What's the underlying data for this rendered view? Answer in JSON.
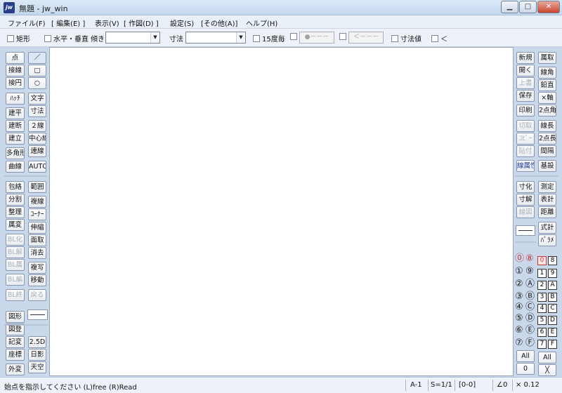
{
  "window": {
    "title": "無題 - jw_win",
    "icon": "jw"
  },
  "menu": [
    "ファイル(F)",
    "[ 編集(E) ]",
    "表示(V)",
    "[ 作図(D) ]",
    "設定(S)",
    "[その他(A)]",
    "ヘルプ(H)"
  ],
  "options": {
    "rect": "矩形",
    "hv": "水平・垂直",
    "slope": "傾き",
    "dim": "寸法",
    "deg15": "15度毎",
    "dotted": "●－－－",
    "arrow": "＜－－－",
    "dimval": "寸法値",
    "lt": "＜"
  },
  "left_tools": {
    "col1": [
      "点",
      "接線",
      "接円",
      "ﾊｯﾁ",
      "建平",
      "建断",
      "建立",
      "多角形",
      "曲線",
      "包絡",
      "分割",
      "整理",
      "属変",
      "BL化",
      "BL解",
      "BL属",
      "BL編",
      "BL終",
      "図形",
      "図登",
      "記変",
      "座標",
      "外変"
    ],
    "col2": [
      "／",
      "□",
      "○",
      "文字",
      "寸法",
      "２線",
      "中心線",
      "連線",
      "AUTO",
      "範囲",
      "複線",
      "ｺｰﾅｰ",
      "伸縮",
      "面取",
      "消去",
      "複写",
      "移動",
      "戻る",
      "2.5D",
      "日影",
      "天空"
    ]
  },
  "right_tools": {
    "col1": [
      "新規",
      "開く",
      "上書",
      "保存",
      "印刷",
      "切取",
      "ｺﾋﾟｰ",
      "貼付",
      "線属性",
      "寸化",
      "寸解",
      "線図",
      "All",
      "0"
    ],
    "col2": [
      "属取",
      "線角",
      "鉛直",
      "×軸",
      "2点角",
      "線長",
      "2点長",
      "間隔",
      "基設",
      "測定",
      "表計",
      "距離",
      "式計",
      "ﾊﾟﾗﾒ",
      "All",
      "╳"
    ],
    "layer_groups": [
      "⓪",
      "①",
      "②",
      "③",
      "④",
      "⑤",
      "⑥",
      "⑦"
    ],
    "layer_groups_b": [
      "⑧",
      "⑨",
      "Ⓐ",
      "Ⓑ",
      "Ⓒ",
      "Ⓓ",
      "Ⓔ",
      "Ⓕ"
    ],
    "layers_a": [
      "0",
      "1",
      "2",
      "3",
      "4",
      "5",
      "6",
      "7"
    ],
    "layers_b": [
      "8",
      "9",
      "A",
      "B",
      "C",
      "D",
      "E",
      "F"
    ]
  },
  "status": {
    "message": "始点を指示してください (L)free (R)Read",
    "paper": "A-1",
    "scale": "S=1/1",
    "layer": "[0-0]",
    "angle": "∠0",
    "zoom": "× 0.12"
  },
  "colors": {
    "accent": "#c43c3c",
    "blue_text": "#1f3b9b",
    "disabled": "#a9afb8"
  }
}
